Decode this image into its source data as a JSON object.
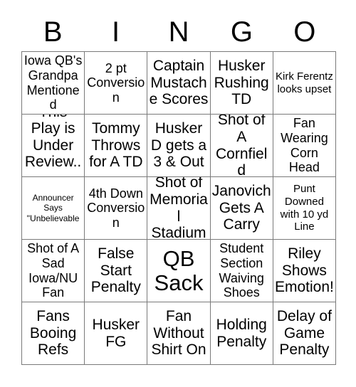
{
  "card": {
    "title": "BINGO",
    "columns": [
      "B",
      "I",
      "N",
      "G",
      "O"
    ],
    "colors": {
      "background": "#ffffff",
      "text": "#000000",
      "grid_line": "#7a7a7a"
    },
    "grid_size": "5x5",
    "rows": [
      [
        {
          "text": "Iowa QB's Grandpa Mentioned",
          "size": "md",
          "marked": false
        },
        {
          "text": "2 pt Conversion",
          "size": "md",
          "marked": false
        },
        {
          "text": "Captain Mustache Scores",
          "size": "lg",
          "marked": false
        },
        {
          "text": "Husker Rushing TD",
          "size": "lg",
          "marked": false
        },
        {
          "text": "Kirk Ferentz looks upset",
          "size": "sm",
          "marked": false
        }
      ],
      [
        {
          "text": "This Play is Under Review...",
          "size": "lg",
          "marked": false
        },
        {
          "text": "Tommy Throws for A TD",
          "size": "lg",
          "marked": false
        },
        {
          "text": "Husker D gets a 3 & Out",
          "size": "lg",
          "marked": false
        },
        {
          "text": "Shot of A Cornfield",
          "size": "lg",
          "marked": false
        },
        {
          "text": "Fan Wearing Corn Head",
          "size": "md",
          "marked": false
        }
      ],
      [
        {
          "text": "Announcer Says \"Unbelievable",
          "size": "xs",
          "marked": false
        },
        {
          "text": "4th Down Conversion",
          "size": "md",
          "marked": false
        },
        {
          "text": "Shot of Memorial Stadium",
          "size": "lg",
          "marked": false
        },
        {
          "text": "Janovich Gets A Carry",
          "size": "lg",
          "marked": false
        },
        {
          "text": "Punt Downed with 10 yd Line",
          "size": "sm",
          "marked": false
        }
      ],
      [
        {
          "text": "Shot of A Sad Iowa/NU Fan",
          "size": "md",
          "marked": false
        },
        {
          "text": "False Start Penalty",
          "size": "lg",
          "marked": false
        },
        {
          "text": "QB Sack",
          "size": "xl",
          "marked": false
        },
        {
          "text": "Student Section Waiving Shoes",
          "size": "md",
          "marked": false
        },
        {
          "text": "Riley Shows Emotion!",
          "size": "lg",
          "marked": false
        }
      ],
      [
        {
          "text": "Fans Booing Refs",
          "size": "lg",
          "marked": false
        },
        {
          "text": "Husker FG",
          "size": "lg",
          "marked": false
        },
        {
          "text": "Fan Without Shirt On",
          "size": "lg",
          "marked": false
        },
        {
          "text": "Holding Penalty",
          "size": "lg",
          "marked": false
        },
        {
          "text": "Delay of Game Penalty",
          "size": "lg",
          "marked": false
        }
      ]
    ]
  }
}
